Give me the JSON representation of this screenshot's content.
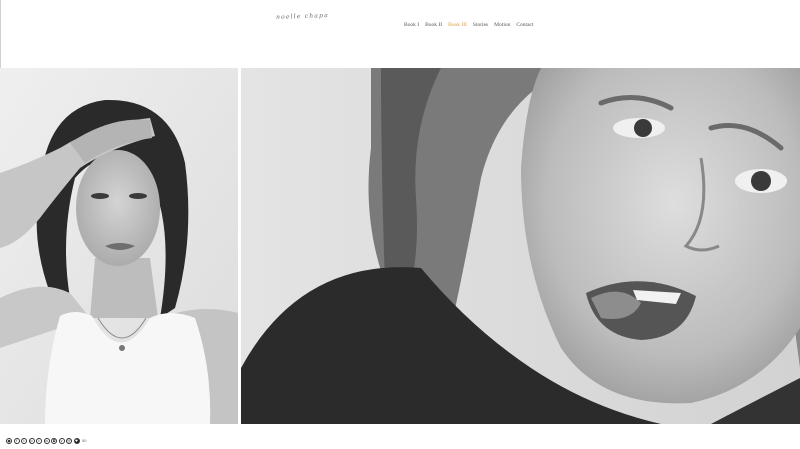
{
  "site": {
    "logo_text": "noelle chapa"
  },
  "nav": {
    "items": [
      {
        "label": "Book I",
        "active": false
      },
      {
        "label": "Book II",
        "active": false
      },
      {
        "label": "Book III",
        "active": true
      },
      {
        "label": "Stories",
        "active": false
      },
      {
        "label": "Motion",
        "active": false
      },
      {
        "label": "Contact",
        "active": false
      }
    ],
    "active_color": "#e09a3a"
  },
  "gallery": {
    "photos": [
      {
        "name": "woman-with-hand-on-forehead-photo",
        "tone": "black-and-white"
      },
      {
        "name": "woman-sticking-out-tongue-photo",
        "tone": "black-and-white"
      }
    ]
  },
  "social": {
    "icons": [
      "circle-icon",
      "facebook-icon",
      "twitter-icon",
      "pinterest-icon",
      "tumblr-icon",
      "linkedin-icon",
      "instagram-icon",
      "vimeo-icon",
      "email-icon",
      "heart-icon"
    ],
    "trailing_text": "00"
  }
}
